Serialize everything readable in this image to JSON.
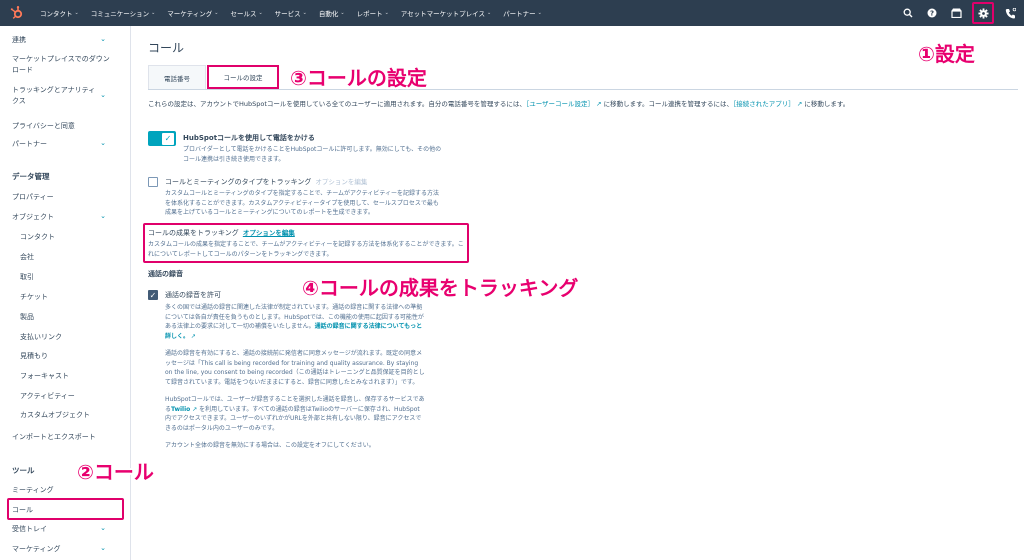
{
  "nav": {
    "items": [
      "コンタクト",
      "コミュニケーション",
      "マーケティング",
      "セールス",
      "サービス",
      "自動化",
      "レポート",
      "アセットマーケットプレイス",
      "パートナー"
    ],
    "icons": [
      "search-icon",
      "help-icon",
      "marketplace-icon",
      "settings-icon",
      "calling-icon"
    ],
    "brand_color": "#ff7a59"
  },
  "sidebar": {
    "items": [
      {
        "label": "連携",
        "chevron": true
      },
      {
        "label": "マーケットプレイスでのダウンロード"
      },
      {
        "label": "トラッキングとアナリティクス",
        "chevron": true
      },
      {
        "label": "プライバシーと同意"
      },
      {
        "label": "パートナー",
        "chevron": true
      }
    ],
    "data_heading": "データ管理",
    "data_items": [
      "プロパティー",
      "オブジェクト",
      "コンタクト",
      "会社",
      "取引",
      "チケット",
      "製品",
      "支払いリンク",
      "見積もり",
      "フォーキャスト",
      "アクティビティー",
      "カスタムオブジェクト",
      "インポートとエクスポート"
    ],
    "tools_heading": "ツール",
    "tools_items": [
      "ミーティング",
      "コール",
      "受信トレイ",
      "マーケティング"
    ]
  },
  "main": {
    "title": "コール",
    "tabs": [
      "電話番号",
      "コールの設定"
    ],
    "desc_pre": "これらの設定は、アカウントでHubSpotコールを使用している全てのユーザーに適用されます。自分の電話番号を管理するには、",
    "desc_link1": "［ユーザーコール設定］",
    "desc_mid": "に移動します。コール連携を管理するには、",
    "desc_link2": "［接続されたアプリ］",
    "desc_post": "に移動します。",
    "setting1_title": "HubSpotコールを使用して電話をかける",
    "setting1_sub": "プロバイダーとして電話をかけることをHubSpotコールに許可します。無効にしても、その他のコール連携は引き続き使用できます。",
    "setting2_title": "コールとミーティングのタイプをトラッキング",
    "setting2_link": "オプションを編集",
    "setting2_sub": "カスタムコールとミーティングのタイプを指定することで、チームがアクティビティーを記録する方法を体系化することができます。カスタムアクティビティータイプを使用して、セールスプロセスで最も成果を上げているコールとミーティングについてのレポートを生成できます。",
    "setting3_title": "コールの成果をトラッキング",
    "setting3_link": "オプションを編集",
    "setting3_sub": "カスタムコールの成果を指定することで、チームがアクティビティーを記録する方法を体系化することができます。これについてレポートしてコールのパターンをトラッキングできます。",
    "rec_heading": "通話の録音",
    "rec_title": "通話の録音を許可",
    "rec_p1": "多くの国では通話の録音に関連した法律が制定されています。通話の録音に関する法律への準拠については各自が責任を負うものとします。HubSpotでは、この機能の使用に起因する可能性がある法律上の要求に対して一切の補償をいたしません。",
    "rec_p1_link": "通話の録音に関する法律についてもっと詳しく。",
    "rec_p2": "通話の録音を有効にすると、通話の接続前に発信者に同意メッセージが流れます。既定の同意メッセージは「This call is being recorded for training and quality assurance. By staying on the line, you consent to being recorded（この通話はトレーニングと品質保証を目的として録音されています。電話をつないだままにすると、録音に同意したとみなされます）」です。",
    "rec_p3_pre": "HubSpotコールでは、ユーザーが録音することを選択した通話を録音し、保存するサービスである",
    "rec_p3_link": "Twilio",
    "rec_p3_post": "を利用しています。すべての通話の録音はTwilioのサーバーに保存され、HubSpot内でアクセスできます。ユーザーのいずれかがURLを外部と共有しない限り、録音にアクセスできるのはポータル内のユーザーのみです。",
    "rec_p4": "アカウント全体の録音を無効にする場合は、この設定をオフにしてください。"
  },
  "annotations": {
    "a1": "①設定",
    "a2": "②コール",
    "a3": "③コールの設定",
    "a4": "④コールの成果をトラッキング",
    "color": "#e8006f"
  }
}
